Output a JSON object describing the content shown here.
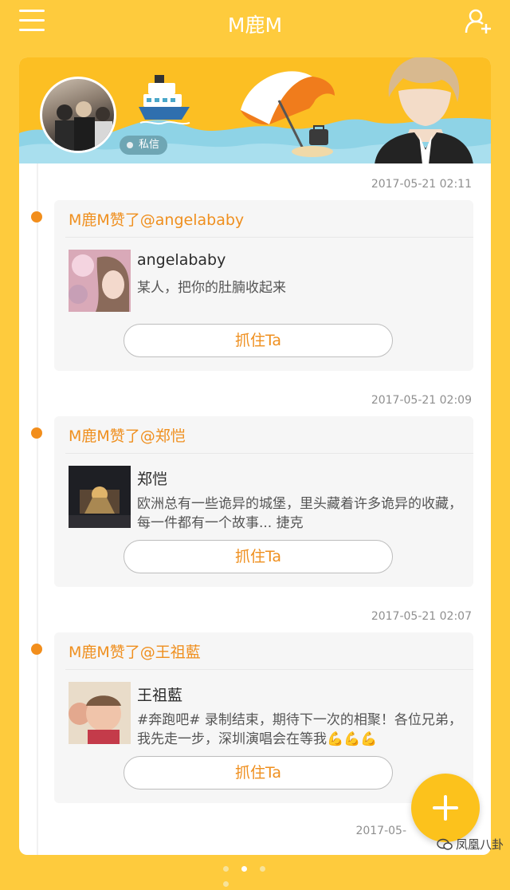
{
  "header": {
    "title": "M鹿M",
    "menu_icon": "menu-icon",
    "add_friend_icon": "add-user-icon"
  },
  "profile": {
    "private_message_label": "私信"
  },
  "feed": [
    {
      "time": "2017-05-21 02:11",
      "action": "M鹿M赞了@angelababy",
      "name": "angelababy",
      "text": "某人，把你的肚腩收起来",
      "button": "抓住Ta"
    },
    {
      "time": "2017-05-21 02:09",
      "action": "M鹿M赞了@郑恺",
      "name": "郑恺",
      "text": "欧洲总有一些诡异的城堡，里头藏着许多诡异的收藏，每一件都有一个故事... 捷克",
      "button": "抓住Ta"
    },
    {
      "time": "2017-05-21 02:07",
      "action": "M鹿M赞了@王祖藍",
      "name": "王祖藍",
      "text": "#奔跑吧# 录制结束，期待下一次的相聚！各位兄弟，我先走一步，深圳演唱会在等我💪💪💪",
      "button": "抓住Ta"
    },
    {
      "time": "2017-05-"
    }
  ],
  "fab": {
    "icon": "plus-icon"
  },
  "watermark": "凤凰八卦",
  "colors": {
    "background": "#fecb3d",
    "accent": "#ef8f1e",
    "banner_wave": "#8ed3e6",
    "fab": "#fcc21c"
  }
}
